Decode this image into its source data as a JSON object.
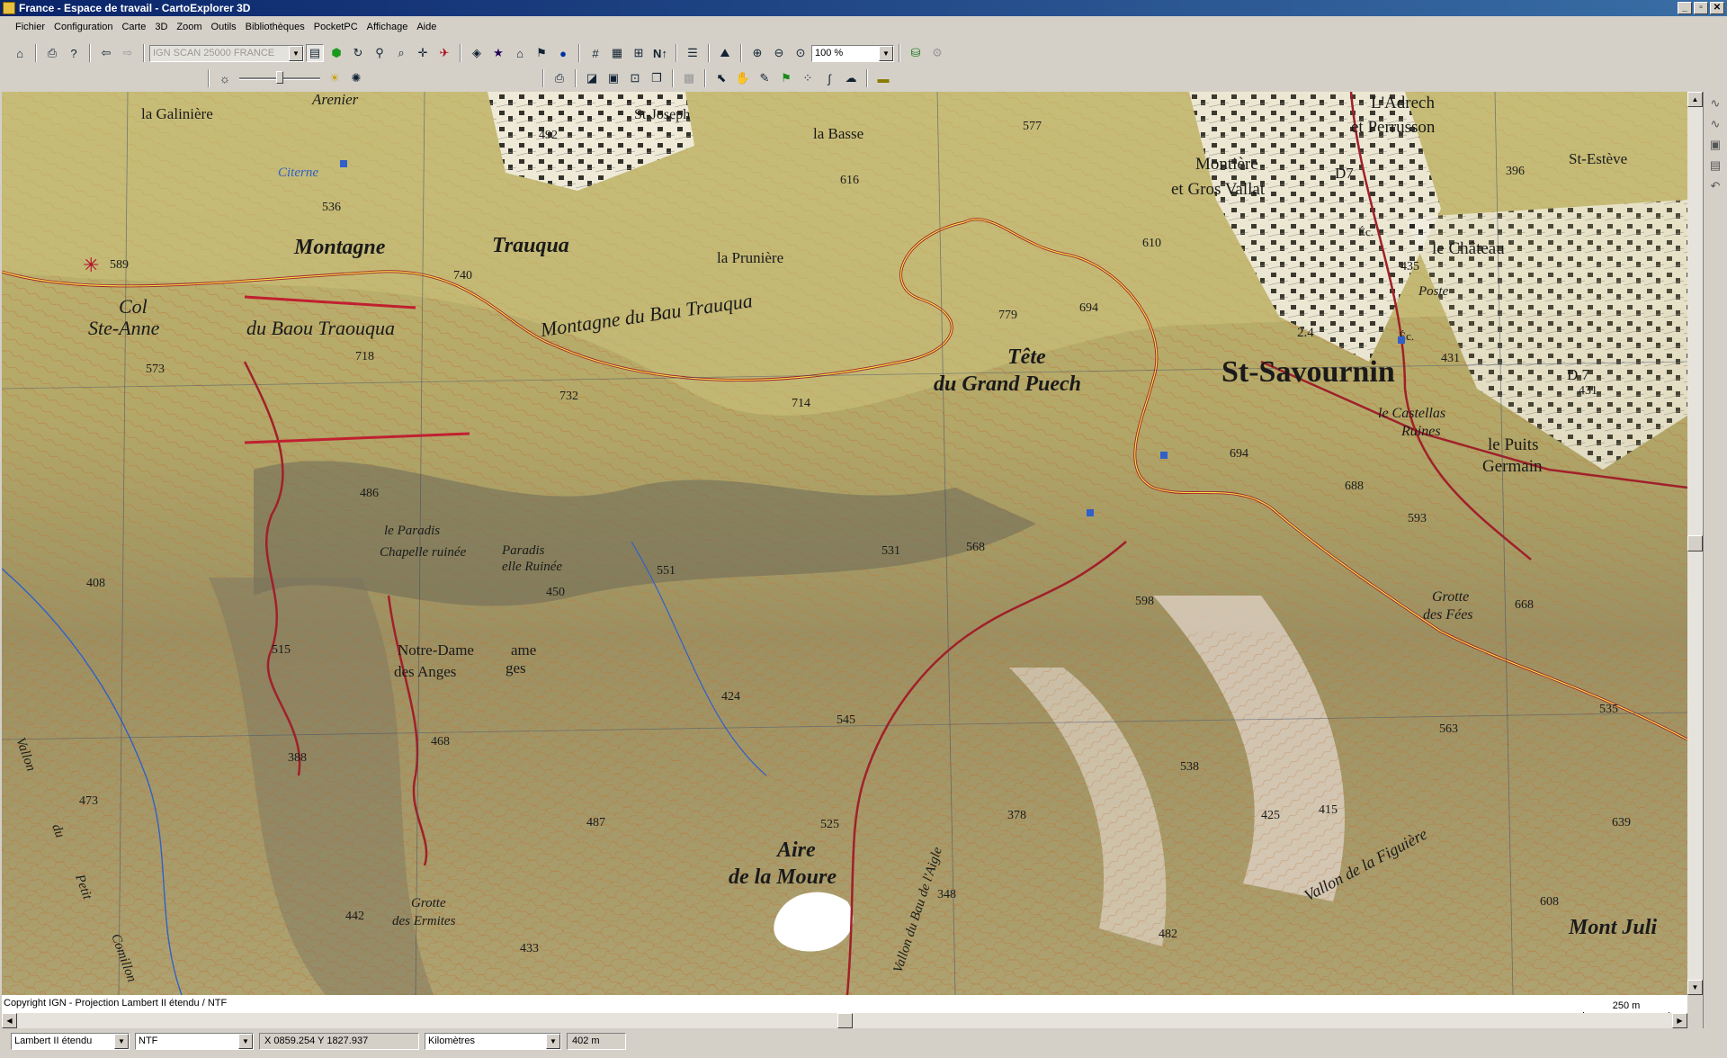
{
  "window": {
    "title": "France - Espace de travail - CartoExplorer 3D",
    "controls": [
      "_",
      "▫",
      "✕"
    ]
  },
  "menu": [
    "Fichier",
    "Configuration",
    "Carte",
    "3D",
    "Zoom",
    "Outils",
    "Bibliothèques",
    "PocketPC",
    "Affichage",
    "Aide"
  ],
  "toolbar": {
    "layer_select": "IGN SCAN 25000 FRANCE",
    "zoom_level": "100 %",
    "north_label": "N",
    "north_arrow": "↑"
  },
  "map": {
    "labels": [
      {
        "t": "la Galinière",
        "cls": "serif"
      },
      {
        "t": "Arenier",
        "cls": "italic"
      },
      {
        "t": "St-Joseph",
        "cls": "serif"
      },
      {
        "t": "492",
        "cls": "alt"
      },
      {
        "t": "la Basse",
        "cls": "serif"
      },
      {
        "t": "616",
        "cls": "alt"
      },
      {
        "t": "577",
        "cls": "alt"
      },
      {
        "t": "L'Adrech",
        "cls": "serif"
      },
      {
        "t": "et Perrusson",
        "cls": "serif"
      },
      {
        "t": "Montière",
        "cls": "serif"
      },
      {
        "t": "et Gros Vallat",
        "cls": "serif"
      },
      {
        "t": "D7",
        "cls": "serif"
      },
      {
        "t": "396",
        "cls": "alt"
      },
      {
        "t": "St-Estève",
        "cls": "serif"
      },
      {
        "t": "Citerne",
        "cls": "water"
      },
      {
        "t": "536",
        "cls": "alt"
      },
      {
        "t": "Montagne",
        "cls": "big"
      },
      {
        "t": "Trauqua",
        "cls": "big"
      },
      {
        "t": "la Prunière",
        "cls": "serif"
      },
      {
        "t": "610",
        "cls": "alt"
      },
      {
        "t": "Éc.",
        "cls": "small"
      },
      {
        "t": "le Château",
        "cls": "serif"
      },
      {
        "t": "589",
        "cls": "alt"
      },
      {
        "t": "740",
        "cls": "alt"
      },
      {
        "t": "435",
        "cls": "alt"
      },
      {
        "t": "Poste",
        "cls": "small"
      },
      {
        "t": "Col",
        "cls": "med"
      },
      {
        "t": "Ste-Anne",
        "cls": "med"
      },
      {
        "t": "du Baou Traouqua",
        "cls": "big"
      },
      {
        "t": "Montagne du Bau Trauqua",
        "cls": "bigr"
      },
      {
        "t": "779",
        "cls": "alt"
      },
      {
        "t": "694",
        "cls": "alt"
      },
      {
        "t": "2.4",
        "cls": "small"
      },
      {
        "t": "Éc.",
        "cls": "small"
      },
      {
        "t": "431",
        "cls": "alt"
      },
      {
        "t": "D 7",
        "cls": "serif"
      },
      {
        "t": "431",
        "cls": "alt"
      },
      {
        "t": "573",
        "cls": "alt"
      },
      {
        "t": "718",
        "cls": "alt"
      },
      {
        "t": "Tête",
        "cls": "big"
      },
      {
        "t": "du Grand Puech",
        "cls": "big"
      },
      {
        "t": "St-Savournin",
        "cls": "huge"
      },
      {
        "t": "732",
        "cls": "alt"
      },
      {
        "t": "714",
        "cls": "alt"
      },
      {
        "t": "le Castellas",
        "cls": "serif"
      },
      {
        "t": "Ruines",
        "cls": "serif"
      },
      {
        "t": "694",
        "cls": "alt"
      },
      {
        "t": "le Puits",
        "cls": "serif"
      },
      {
        "t": "Germain",
        "cls": "serif"
      },
      {
        "t": "688",
        "cls": "alt"
      },
      {
        "t": "486",
        "cls": "alt"
      },
      {
        "t": "593",
        "cls": "alt"
      },
      {
        "t": "le Paradis",
        "cls": "serif"
      },
      {
        "t": "Chapelle ruinée",
        "cls": "serif"
      },
      {
        "t": "Paradis",
        "cls": "serif"
      },
      {
        "t": "elle Ruinée",
        "cls": "serif"
      },
      {
        "t": "531",
        "cls": "alt"
      },
      {
        "t": "568",
        "cls": "alt"
      },
      {
        "t": "408",
        "cls": "alt"
      },
      {
        "t": "551",
        "cls": "alt"
      },
      {
        "t": "450",
        "cls": "alt"
      },
      {
        "t": "598",
        "cls": "alt"
      },
      {
        "t": "Grotte",
        "cls": "serif"
      },
      {
        "t": "des Fées",
        "cls": "serif"
      },
      {
        "t": "668",
        "cls": "alt"
      },
      {
        "t": "515",
        "cls": "alt"
      },
      {
        "t": "Notre-Dame",
        "cls": "serif"
      },
      {
        "t": "des Anges",
        "cls": "serif"
      },
      {
        "t": "ame",
        "cls": "serif"
      },
      {
        "t": "ges",
        "cls": "serif"
      },
      {
        "t": "424",
        "cls": "alt"
      },
      {
        "t": "545",
        "cls": "alt"
      },
      {
        "t": "535",
        "cls": "alt"
      },
      {
        "t": "468",
        "cls": "alt"
      },
      {
        "t": "563",
        "cls": "alt"
      },
      {
        "t": "388",
        "cls": "alt"
      },
      {
        "t": "538",
        "cls": "alt"
      },
      {
        "t": "473",
        "cls": "alt"
      },
      {
        "t": "525",
        "cls": "alt"
      },
      {
        "t": "378",
        "cls": "alt"
      },
      {
        "t": "425",
        "cls": "alt"
      },
      {
        "t": "415",
        "cls": "alt"
      },
      {
        "t": "639",
        "cls": "alt"
      },
      {
        "t": "487",
        "cls": "alt"
      },
      {
        "t": "Aire",
        "cls": "big"
      },
      {
        "t": "de la Moure",
        "cls": "big"
      },
      {
        "t": "Vallon du Bau de l'Aigle",
        "cls": "vr"
      },
      {
        "t": "Vallon de la Figuière",
        "cls": "vr2"
      },
      {
        "t": "348",
        "cls": "alt"
      },
      {
        "t": "608",
        "cls": "alt"
      },
      {
        "t": "442",
        "cls": "alt"
      },
      {
        "t": "Grotte",
        "cls": "serif"
      },
      {
        "t": "des Ermites",
        "cls": "serif"
      },
      {
        "t": "482",
        "cls": "alt"
      },
      {
        "t": "Mont Juli",
        "cls": "big"
      },
      {
        "t": "433",
        "cls": "alt"
      },
      {
        "t": "Vallon",
        "cls": "vr3"
      },
      {
        "t": "du",
        "cls": "vr3"
      },
      {
        "t": "Petit",
        "cls": "vr3"
      },
      {
        "t": "Comillon",
        "cls": "vr3"
      }
    ]
  },
  "info": {
    "copyright": "Copyright IGN - Projection Lambert II étendu / NTF",
    "scale_label": "250 m"
  },
  "status": {
    "projection": "Lambert II étendu",
    "datum": "NTF",
    "coords": "X 0859.254  Y 1827.937",
    "units": "Kilomètres",
    "altitude": "402 m"
  },
  "colors": {
    "road": "#a0202a",
    "water": "#3060c8",
    "contour": "#c07a3a",
    "terrain": "#b9b06a",
    "forest": "#9aa85a"
  },
  "scrollbars": {
    "vertical_position": 0.5,
    "horizontal_position": 0.5
  }
}
